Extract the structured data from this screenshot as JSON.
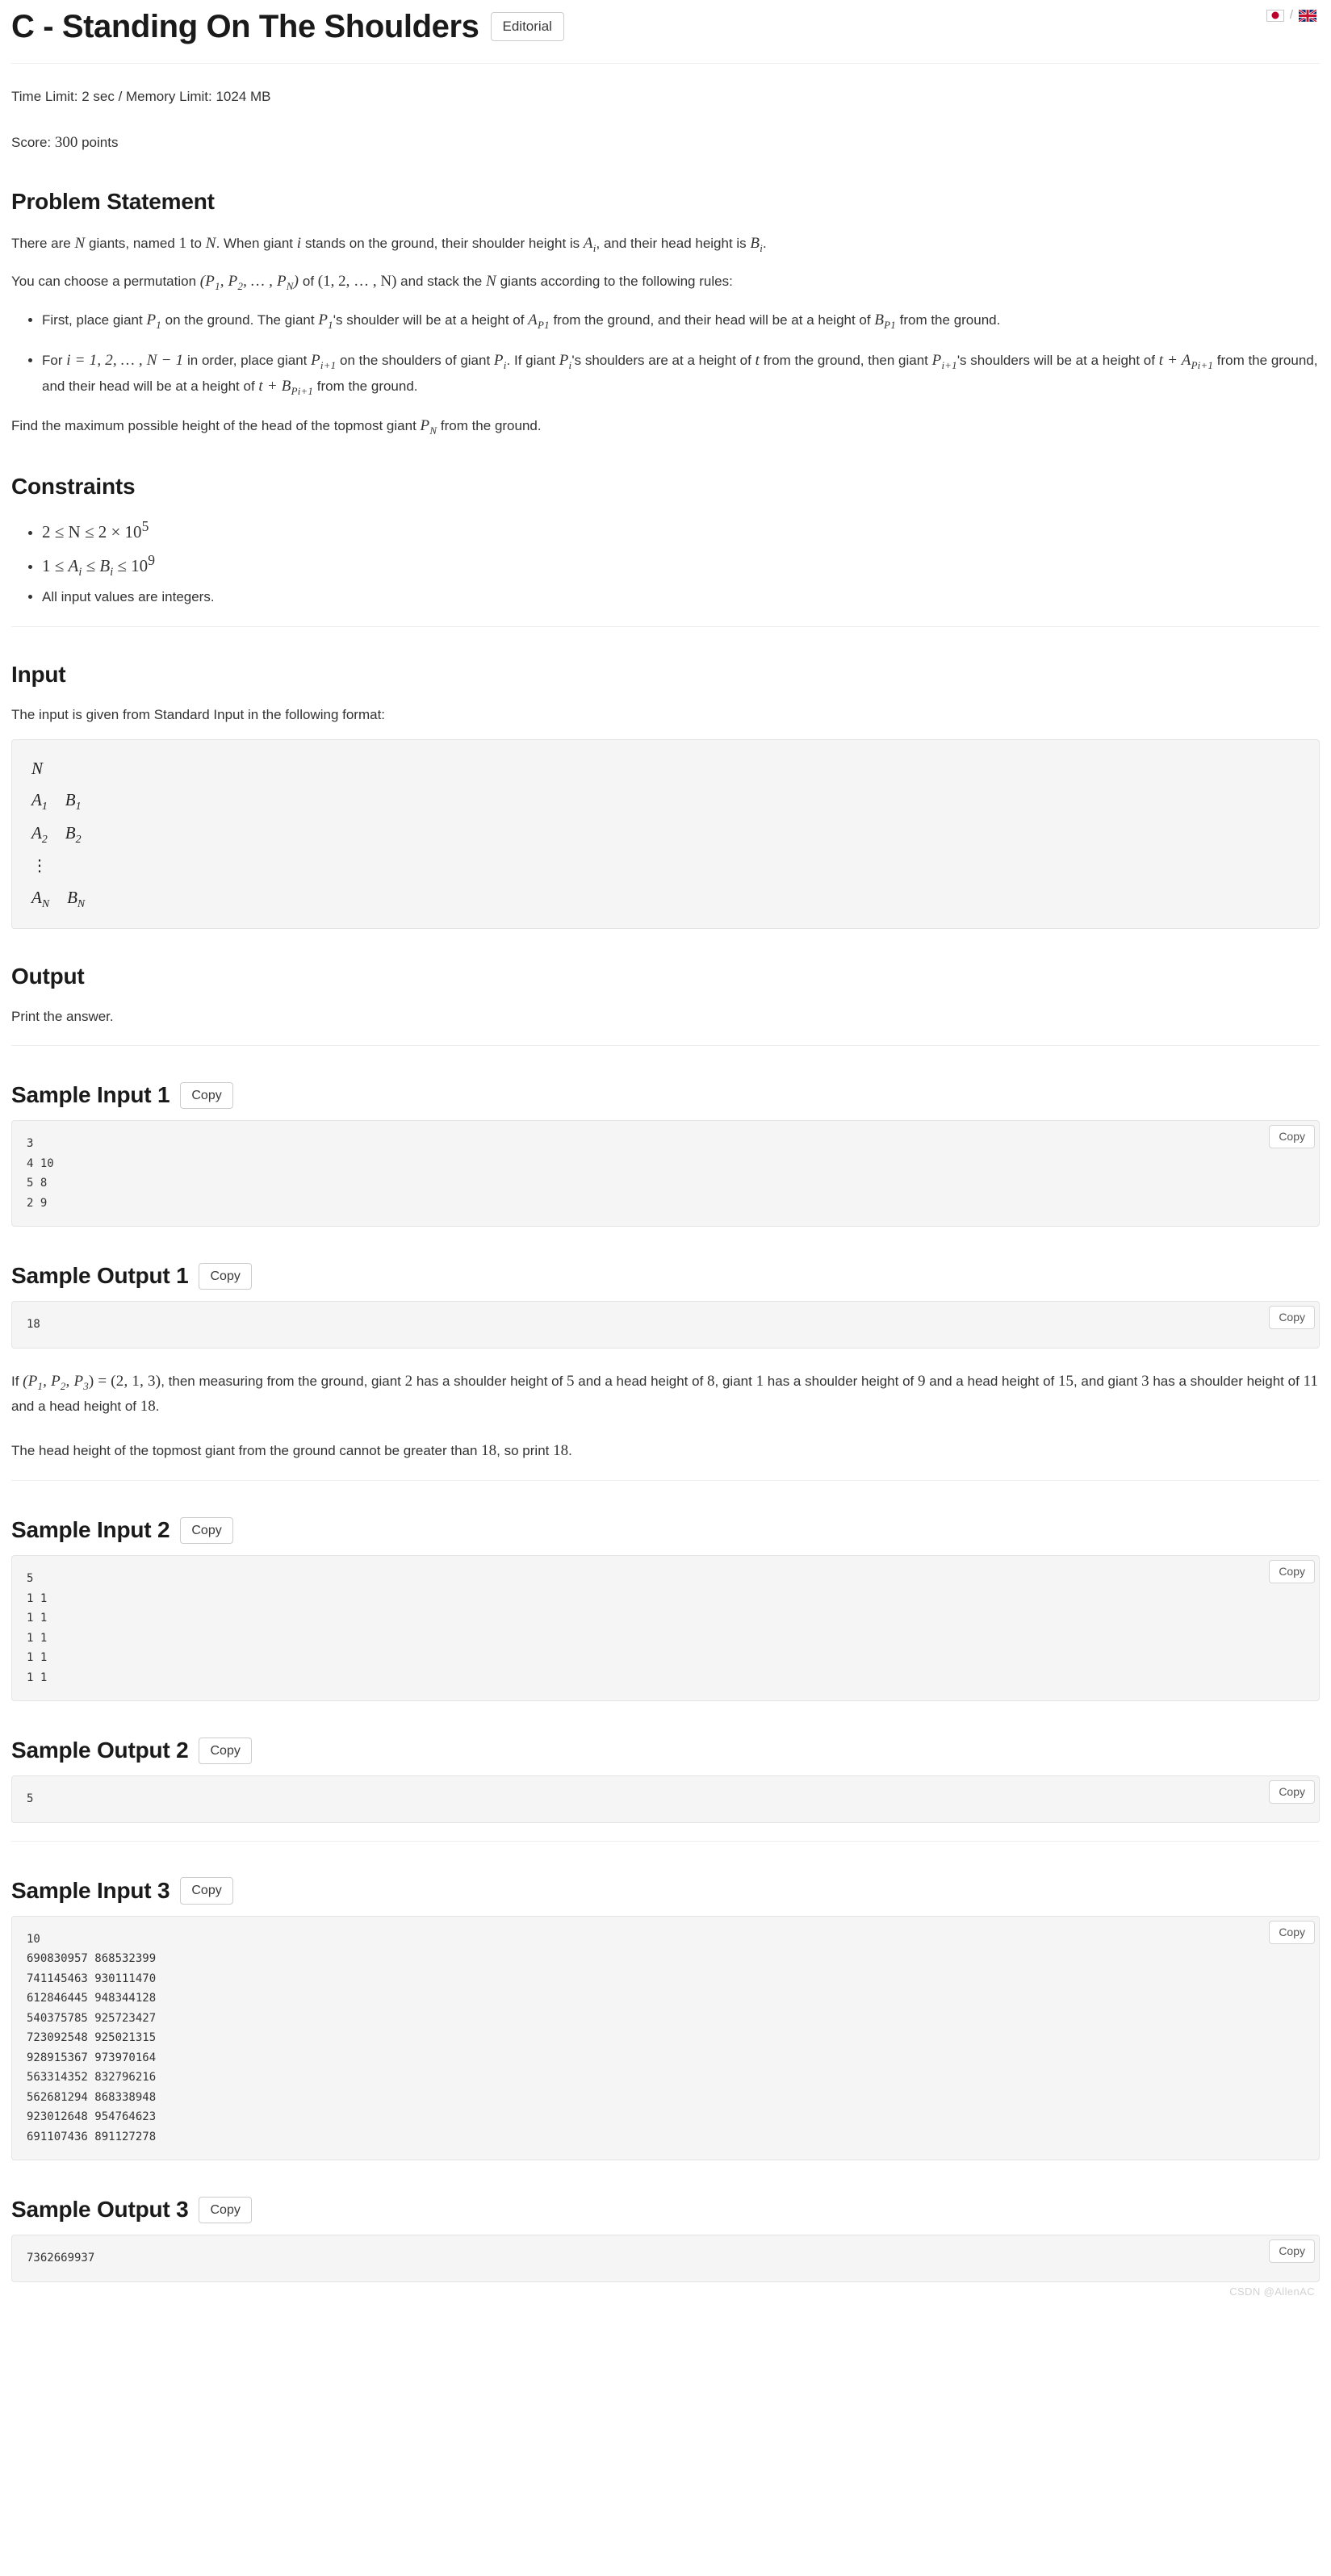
{
  "header": {
    "title": "C - Standing On The Shoulders",
    "editorial_label": "Editorial",
    "lang_separator": "/",
    "lang_jp": "japanese-flag",
    "lang_en": "uk-flag"
  },
  "meta": {
    "limits_prefix": "Time Limit: 2 sec / Memory Limit: 1024 MB",
    "score_prefix": "Score: ",
    "score_value": "300",
    "score_suffix": " points"
  },
  "problem_statement": {
    "heading": "Problem Statement",
    "p1": {
      "t1": "There are ",
      "m1": "N",
      "t2": " giants, named ",
      "m2": "1",
      "t3": " to ",
      "m3": "N",
      "t4": ". When giant ",
      "m4": "i",
      "t5": " stands on the ground, their shoulder height is ",
      "m5": "A",
      "m5sub": "i",
      "t6": ", and their head height is ",
      "m6": "B",
      "m6sub": "i",
      "t7": "."
    },
    "p2": {
      "t1": "You can choose a permutation ",
      "m1": "(P",
      "m1s1": "1",
      "m1b": ", P",
      "m1s2": "2",
      "m1c": ", … , P",
      "m1s3": "N",
      "m1d": ")",
      "t2": " of ",
      "m2": "(1, 2, … , N)",
      "t3": " and stack the ",
      "m3": "N",
      "t4": " giants according to the following rules:"
    },
    "rules": [
      {
        "t1": "First, place giant ",
        "m1": "P",
        "m1sub": "1",
        "t2": " on the ground. The giant ",
        "m2": "P",
        "m2sub": "1",
        "t3": "'s shoulder will be at a height of ",
        "m3": "A",
        "m3sub": "P1",
        "t4": " from the ground, and their head will be at a height of ",
        "m4": "B",
        "m4sub": "P1",
        "t5": " from the ground."
      },
      {
        "t1": "For ",
        "m1": "i = 1, 2, … , N − 1",
        "t2": " in order, place giant ",
        "m2": "P",
        "m2sub": "i+1",
        "t3": " on the shoulders of giant ",
        "m3": "P",
        "m3sub": "i",
        "t4": ". If giant ",
        "m4": "P",
        "m4sub": "i",
        "t5": "'s shoulders are at a height of ",
        "m5": "t",
        "t6": " from the ground, then giant ",
        "m6": "P",
        "m6sub": "i+1",
        "t7": "'s shoulders will be at a height of ",
        "m7": "t + A",
        "m7sub": "Pi+1",
        "t8": " from the ground, and their head will be at a height of ",
        "m8": "t + B",
        "m8sub": "Pi+1",
        "t9": " from the ground."
      }
    ],
    "p3": {
      "t1": "Find the maximum possible height of the head of the topmost giant ",
      "m1": "P",
      "m1sub": "N",
      "t2": " from the ground."
    }
  },
  "constraints": {
    "heading": "Constraints",
    "items": [
      {
        "expr": "2 ≤ N ≤ 2 × 10",
        "sup": "5",
        "math": true
      },
      {
        "expr": "1 ≤ A_i ≤ B_i ≤ 10",
        "sup": "9",
        "math": true
      },
      {
        "expr": "All input values are integers.",
        "sup": "",
        "math": false
      }
    ]
  },
  "input": {
    "heading": "Input",
    "description": "The input is given from Standard Input in the following format:",
    "format_lines": [
      {
        "a": "N",
        "b": ""
      },
      {
        "a": "A",
        "asub": "1",
        "b": "B",
        "bsub": "1"
      },
      {
        "a": "A",
        "asub": "2",
        "b": "B",
        "bsub": "2"
      },
      {
        "a": "⋮",
        "b": ""
      },
      {
        "a": "A",
        "asub": "N",
        "b": "B",
        "bsub": "N"
      }
    ]
  },
  "output": {
    "heading": "Output",
    "description": "Print the answer."
  },
  "copy_label": "Copy",
  "samples": [
    {
      "input_heading": "Sample Input 1",
      "input_text": "3\n4 10\n5 8\n2 9",
      "output_heading": "Sample Output 1",
      "output_text": "18",
      "explanation": [
        {
          "t1": "If ",
          "m1": "(P",
          "m1s1": "1",
          "m1b": ", P",
          "m1s2": "2",
          "m1c": ", P",
          "m1s3": "3",
          "m1d": ") = (2, 1, 3)",
          "t2": ", then measuring from the ground, giant ",
          "m2": "2",
          "t3": " has a shoulder height of ",
          "m3": "5",
          "t4": " and a head height of ",
          "m4": "8",
          "t5": ", giant ",
          "m5": "1",
          "t6": " has a shoulder height of ",
          "m6": "9",
          "t7": " and a head height of ",
          "m7": "15",
          "t8": ", and giant ",
          "m8": "3",
          "t9": " has a shoulder height of ",
          "m9": "11",
          "t10": " and a head height of ",
          "m10": "18",
          "t11": "."
        },
        {
          "t1": "The head height of the topmost giant from the ground cannot be greater than ",
          "m1": "18",
          "t2": ", so print ",
          "m2": "18",
          "t3": "."
        }
      ]
    },
    {
      "input_heading": "Sample Input 2",
      "input_text": "5\n1 1\n1 1\n1 1\n1 1\n1 1",
      "output_heading": "Sample Output 2",
      "output_text": "5"
    },
    {
      "input_heading": "Sample Input 3",
      "input_text": "10\n690830957 868532399\n741145463 930111470\n612846445 948344128\n540375785 925723427\n723092548 925021315\n928915367 973970164\n563314352 832796216\n562681294 868338948\n923012648 954764623\n691107436 891127278",
      "output_heading": "Sample Output 3",
      "output_text": "7362669937"
    }
  ],
  "watermark": "CSDN @AllenAC",
  "colors": {
    "code_bg": "#f5f5f5",
    "code_border": "#e4e4e4",
    "text": "#333333",
    "heading": "#1a1a1a",
    "jp_flag_red": "#bc002d"
  }
}
